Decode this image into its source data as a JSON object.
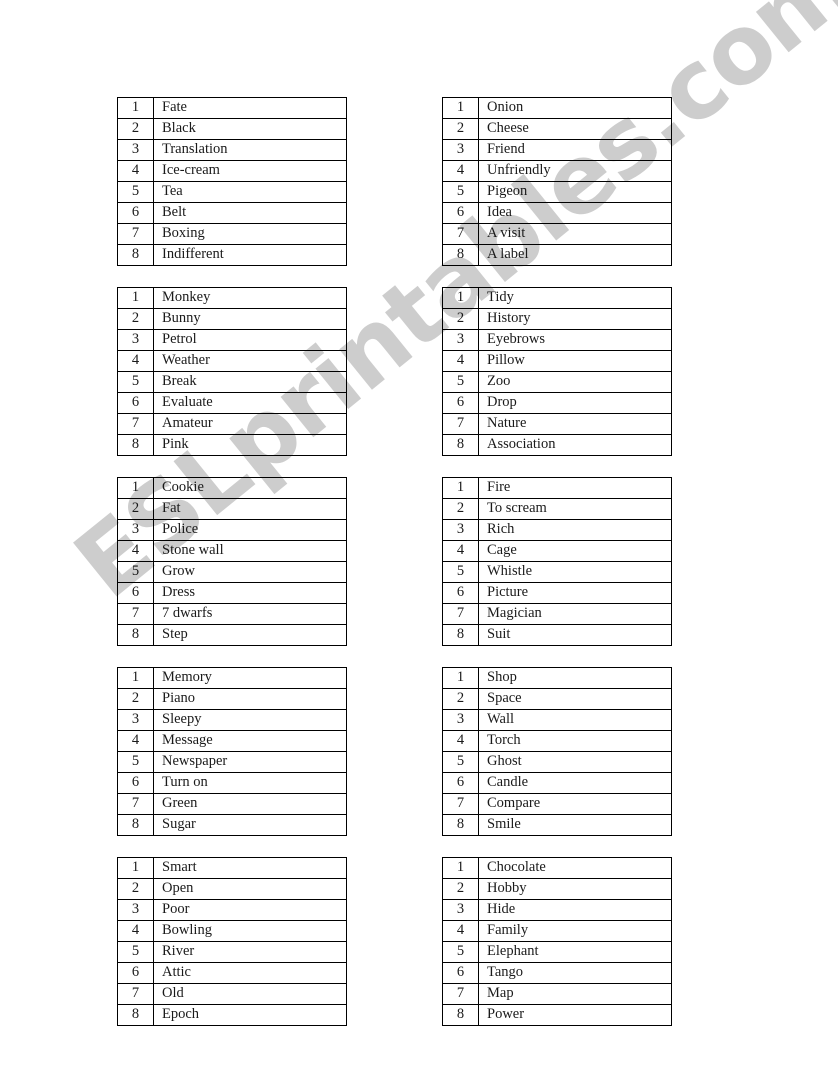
{
  "document": {
    "title": "Word List Worksheet",
    "watermark": "ESLprintables.com",
    "watermark_color": "#cdcdcd",
    "page_background": "#ffffff",
    "border_color": "#000000",
    "text_color": "#1a1a1a"
  },
  "columns": [
    {
      "name": "left-column",
      "tables": [
        {
          "name": "table-1",
          "rows": [
            {
              "num": "1",
              "word": "Fate"
            },
            {
              "num": "2",
              "word": "Black"
            },
            {
              "num": "3",
              "word": "Translation"
            },
            {
              "num": "4",
              "word": "Ice-cream"
            },
            {
              "num": "5",
              "word": "Tea"
            },
            {
              "num": "6",
              "word": "Belt"
            },
            {
              "num": "7",
              "word": "Boxing"
            },
            {
              "num": "8",
              "word": "Indifferent"
            }
          ]
        },
        {
          "name": "table-3",
          "rows": [
            {
              "num": "1",
              "word": "Monkey"
            },
            {
              "num": "2",
              "word": "Bunny"
            },
            {
              "num": "3",
              "word": "Petrol"
            },
            {
              "num": "4",
              "word": "Weather"
            },
            {
              "num": "5",
              "word": "Break"
            },
            {
              "num": "6",
              "word": "Evaluate"
            },
            {
              "num": "7",
              "word": "Amateur"
            },
            {
              "num": "8",
              "word": "Pink"
            }
          ]
        },
        {
          "name": "table-5",
          "rows": [
            {
              "num": "1",
              "word": "Cookie"
            },
            {
              "num": "2",
              "word": "Fat"
            },
            {
              "num": "3",
              "word": "Police"
            },
            {
              "num": "4",
              "word": "Stone wall"
            },
            {
              "num": "5",
              "word": "Grow"
            },
            {
              "num": "6",
              "word": "Dress"
            },
            {
              "num": "7",
              "word": "7 dwarfs"
            },
            {
              "num": "8",
              "word": "Step"
            }
          ]
        },
        {
          "name": "table-7",
          "rows": [
            {
              "num": "1",
              "word": "Memory"
            },
            {
              "num": "2",
              "word": "Piano"
            },
            {
              "num": "3",
              "word": "Sleepy"
            },
            {
              "num": "4",
              "word": "Message"
            },
            {
              "num": "5",
              "word": "Newspaper"
            },
            {
              "num": "6",
              "word": "Turn on"
            },
            {
              "num": "7",
              "word": "Green"
            },
            {
              "num": "8",
              "word": "Sugar"
            }
          ]
        },
        {
          "name": "table-9",
          "rows": [
            {
              "num": "1",
              "word": "Smart"
            },
            {
              "num": "2",
              "word": "Open"
            },
            {
              "num": "3",
              "word": "Poor"
            },
            {
              "num": "4",
              "word": "Bowling"
            },
            {
              "num": "5",
              "word": "River"
            },
            {
              "num": "6",
              "word": "Attic"
            },
            {
              "num": "7",
              "word": "Old"
            },
            {
              "num": "8",
              "word": "Epoch"
            }
          ]
        }
      ]
    },
    {
      "name": "right-column",
      "tables": [
        {
          "name": "table-2",
          "rows": [
            {
              "num": "1",
              "word": "Onion"
            },
            {
              "num": "2",
              "word": "Cheese"
            },
            {
              "num": "3",
              "word": "Friend"
            },
            {
              "num": "4",
              "word": "Unfriendly"
            },
            {
              "num": "5",
              "word": "Pigeon"
            },
            {
              "num": "6",
              "word": "Idea"
            },
            {
              "num": "7",
              "word": "A visit"
            },
            {
              "num": "8",
              "word": "A label"
            }
          ]
        },
        {
          "name": "table-4",
          "rows": [
            {
              "num": "1",
              "word": "Tidy"
            },
            {
              "num": "2",
              "word": "History"
            },
            {
              "num": "3",
              "word": "Eyebrows"
            },
            {
              "num": "4",
              "word": "Pillow"
            },
            {
              "num": "5",
              "word": "Zoo"
            },
            {
              "num": "6",
              "word": "Drop"
            },
            {
              "num": "7",
              "word": "Nature"
            },
            {
              "num": "8",
              "word": "Association"
            }
          ]
        },
        {
          "name": "table-6",
          "rows": [
            {
              "num": "1",
              "word": "Fire"
            },
            {
              "num": "2",
              "word": "To scream"
            },
            {
              "num": "3",
              "word": "Rich"
            },
            {
              "num": "4",
              "word": "Cage"
            },
            {
              "num": "5",
              "word": "Whistle"
            },
            {
              "num": "6",
              "word": "Picture"
            },
            {
              "num": "7",
              "word": "Magician"
            },
            {
              "num": "8",
              "word": "Suit"
            }
          ]
        },
        {
          "name": "table-8",
          "rows": [
            {
              "num": "1",
              "word": "Shop"
            },
            {
              "num": "2",
              "word": "Space"
            },
            {
              "num": "3",
              "word": "Wall"
            },
            {
              "num": "4",
              "word": "Torch"
            },
            {
              "num": "5",
              "word": "Ghost"
            },
            {
              "num": "6",
              "word": "Candle"
            },
            {
              "num": "7",
              "word": "Compare"
            },
            {
              "num": "8",
              "word": "Smile"
            }
          ]
        },
        {
          "name": "table-10",
          "rows": [
            {
              "num": "1",
              "word": "Chocolate"
            },
            {
              "num": "2",
              "word": "Hobby"
            },
            {
              "num": "3",
              "word": "Hide"
            },
            {
              "num": "4",
              "word": "Family"
            },
            {
              "num": "5",
              "word": "Elephant"
            },
            {
              "num": "6",
              "word": "Tango"
            },
            {
              "num": "7",
              "word": "Map"
            },
            {
              "num": "8",
              "word": "Power"
            }
          ]
        }
      ]
    }
  ]
}
